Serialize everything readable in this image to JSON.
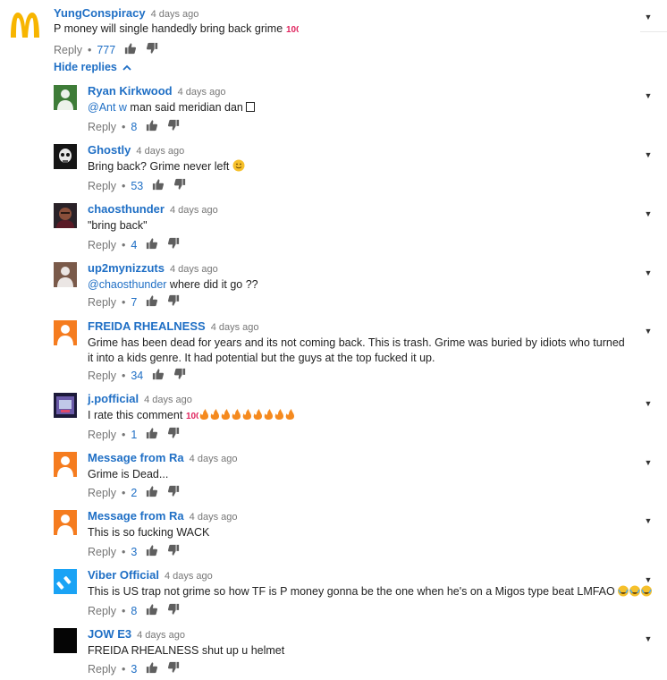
{
  "top_comment": {
    "author": "YungConspiracy",
    "time": "4 days ago",
    "text": "P money will single handedly bring back grime",
    "reply_label": "Reply",
    "likes": "777"
  },
  "hide_replies_label": "Hide replies",
  "replies": [
    {
      "author": "Ryan Kirkwood",
      "time": "4 days ago",
      "mention": "@Ant w",
      "text": " man said meridian dan ",
      "reply_label": "Reply",
      "likes": "8"
    },
    {
      "author": "Ghostly",
      "time": "4 days ago",
      "text": "Bring back? Grime never left",
      "reply_label": "Reply",
      "likes": "53"
    },
    {
      "author": "chaosthunder",
      "time": "4 days ago",
      "text": "\"bring back\"",
      "reply_label": "Reply",
      "likes": "4"
    },
    {
      "author": "up2mynizzuts",
      "time": "4 days ago",
      "mention": "@chaosthunder",
      "text": " where did it go ??",
      "reply_label": "Reply",
      "likes": "7"
    },
    {
      "author": "FREIDA RHEALNESS",
      "time": "4 days ago",
      "text": "Grime has been dead for years and its not coming back. This is trash. Grime was buried by idiots who turned it into a kids genre. It had potential but the guys at the top fucked it up.",
      "reply_label": "Reply",
      "likes": "34"
    },
    {
      "author": "j.pofficial",
      "time": "4 days ago",
      "text": "I rate this comment",
      "reply_label": "Reply",
      "likes": "1"
    },
    {
      "author": "Message from Ra",
      "time": "4 days ago",
      "text": "Grime is Dead...",
      "reply_label": "Reply",
      "likes": "2"
    },
    {
      "author": "Message from Ra",
      "time": "4 days ago",
      "text": "This is so fucking WACK",
      "reply_label": "Reply",
      "likes": "3"
    },
    {
      "author": "Viber Official",
      "time": "4 days ago",
      "text": "This is US trap not grime so how TF is P money gonna be the one when he's on a Migos type beat LMFAO",
      "reply_label": "Reply",
      "likes": "8"
    },
    {
      "author": "JOW E3",
      "time": "4 days ago",
      "text": "FREIDA RHEALNESS shut up u helmet",
      "reply_label": "Reply",
      "likes": "3"
    }
  ],
  "icons": {
    "like": "thumbs-up-icon",
    "dislike": "thumbs-down-icon",
    "menu": "caret-down-icon",
    "chevron": "chevron-up-icon"
  },
  "colors": {
    "link_blue": "#1f6fc5",
    "muted": "#767676",
    "mcd_red": "#fff",
    "mcd_yellow": "#f7b500",
    "orange_avatar": "#f57c1f",
    "viber_blue": "#1aa3f5"
  }
}
